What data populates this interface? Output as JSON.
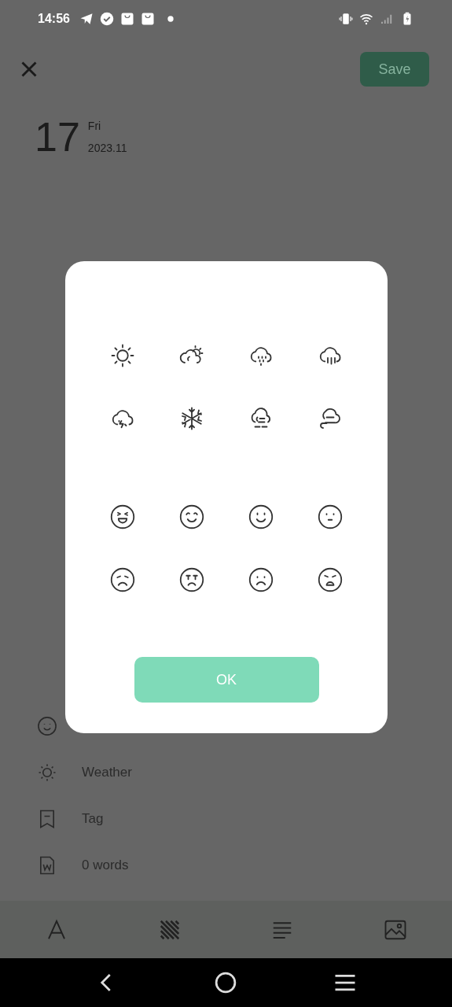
{
  "status_bar": {
    "time": "14:56"
  },
  "header": {
    "save": "Save"
  },
  "date": {
    "day": "17",
    "weekday": "Fri",
    "month": "2023.11"
  },
  "rows": [
    {
      "kind": "mood"
    },
    {
      "kind": "weather",
      "label": "Weather"
    },
    {
      "kind": "tag",
      "label": "Tag"
    },
    {
      "kind": "words",
      "label": "0 words"
    }
  ],
  "dialog": {
    "button": "OK"
  }
}
